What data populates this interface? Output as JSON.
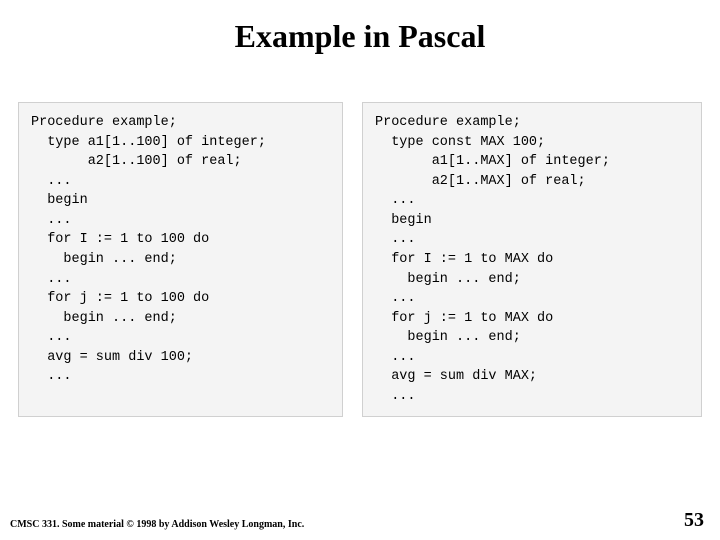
{
  "title": "Example in Pascal",
  "code_left": "Procedure example;\n  type a1[1..100] of integer;\n       a2[1..100] of real;\n  ...\n  begin\n  ...\n  for I := 1 to 100 do\n    begin ... end;\n  ...\n  for j := 1 to 100 do\n    begin ... end;\n  ...\n  avg = sum div 100;\n  ...",
  "code_right": "Procedure example;\n  type const MAX 100;\n       a1[1..MAX] of integer;\n       a2[1..MAX] of real;\n  ...\n  begin\n  ...\n  for I := 1 to MAX do\n    begin ... end;\n  ...\n  for j := 1 to MAX do\n    begin ... end;\n  ...\n  avg = sum div MAX;\n  ...",
  "footer_left": "CMSC 331. Some material © 1998 by Addison Wesley Longman, Inc.",
  "page_number": "53"
}
